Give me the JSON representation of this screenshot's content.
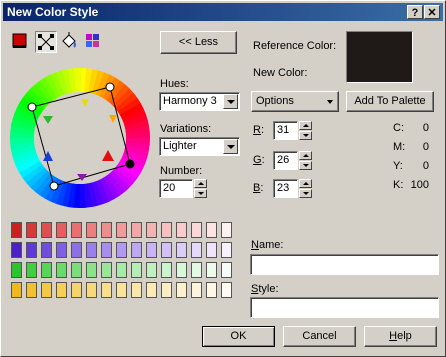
{
  "window": {
    "title": "New Color Style"
  },
  "titlebar_buttons": {
    "help": "?",
    "close": "✕"
  },
  "tools": [
    {
      "name": "solid-color-tool-icon"
    },
    {
      "name": "harmony-tool-icon"
    },
    {
      "name": "fill-tool-icon"
    },
    {
      "name": "palette-tool-icon"
    }
  ],
  "less_button": "<< Less",
  "hues": {
    "label": "Hues:",
    "value": "Harmony 3"
  },
  "variations": {
    "label": "Variations:",
    "value": "Lighter"
  },
  "number": {
    "label": "Number:",
    "value": "20"
  },
  "reference_color": {
    "label": "Reference Color:",
    "color": "#1f1a17"
  },
  "new_color": {
    "label": "New Color:"
  },
  "options_button": "Options",
  "add_to_palette": "Add To Palette",
  "rgb": [
    {
      "key": "R",
      "rest": ":",
      "value": "31"
    },
    {
      "key": "G",
      "rest": ":",
      "value": "26"
    },
    {
      "key": "B",
      "rest": ":",
      "value": "23"
    }
  ],
  "cmyk": [
    {
      "label": "C:",
      "value": "0"
    },
    {
      "label": "M:",
      "value": "0"
    },
    {
      "label": "Y:",
      "value": "0"
    },
    {
      "label": "K:",
      "value": "100"
    }
  ],
  "name_field": {
    "key": "N",
    "rest": "ame:",
    "value": ""
  },
  "style_field": {
    "key": "S",
    "rest": "tyle:",
    "value": ""
  },
  "ok_button": "OK",
  "cancel_button": "Cancel",
  "help_button": {
    "key": "H",
    "rest": "elp"
  },
  "swatch_rows": [
    [
      "#cc1f1f",
      "#d63a3a",
      "#de4f4f",
      "#e46060",
      "#e87070",
      "#ec8080",
      "#ee8d8d",
      "#f09a9a",
      "#f2a7a7",
      "#f4b3b3",
      "#f6c0c0",
      "#f8cccc",
      "#fad8d8",
      "#fce4e4",
      "#fef0f0"
    ],
    [
      "#4f1fcc",
      "#603ad6",
      "#704fde",
      "#7f60e4",
      "#8d70e8",
      "#9a80ec",
      "#a68dee",
      "#b29af0",
      "#bda7f2",
      "#c8b3f4",
      "#d2c0f6",
      "#dcccf8",
      "#e6d8fa",
      "#efe4fc",
      "#f7f0fe"
    ],
    [
      "#2cc42c",
      "#45cc45",
      "#58d458",
      "#6ada6a",
      "#7bde7b",
      "#8be28b",
      "#99e699",
      "#a7eaa7",
      "#b4eeb4",
      "#c0f0c0",
      "#ccf4cc",
      "#d8f6d8",
      "#e3f9e3",
      "#edfbed",
      "#f6fdf6"
    ],
    [
      "#f0b81a",
      "#f2c030",
      "#f4c845",
      "#f5cf58",
      "#f6d46a",
      "#f7d97b",
      "#f8de8b",
      "#f9e29a",
      "#fae6a8",
      "#fbeab6",
      "#fcedc3",
      "#fcf0cf",
      "#fdf4db",
      "#fef7e6",
      "#fefbf2"
    ]
  ]
}
